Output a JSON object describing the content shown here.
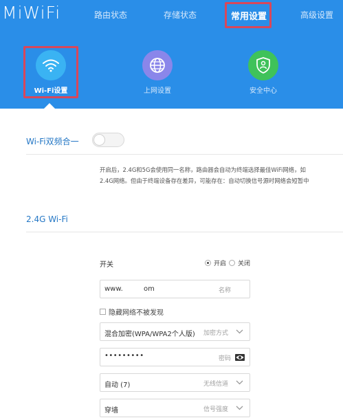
{
  "header": {
    "logo": "MiWiFi",
    "nav": [
      {
        "label": "路由状态"
      },
      {
        "label": "存储状态"
      },
      {
        "label": "常用设置"
      },
      {
        "label": "高级设置"
      }
    ],
    "sub_nav": [
      {
        "label": "Wi-Fi设置",
        "icon": "wifi-icon"
      },
      {
        "label": "上网设置",
        "icon": "globe-icon"
      },
      {
        "label": "安全中心",
        "icon": "shield-icon"
      }
    ]
  },
  "dual_band": {
    "label": "Wi-Fi双频合一",
    "enabled": false,
    "desc_line1": "开启后，2.4G和5G会使用同一名称，路由器会自动为终端选择最佳WiFi网络，如",
    "desc_line2": "2.4G网络。但由于终端设备存在差异，可能存在：自动切换信号源时网络会短暂中"
  },
  "wifi24": {
    "section_title": "2.4G Wi-Fi",
    "switch_label": "开关",
    "switch_on": "开启",
    "switch_off": "关闭",
    "ssid_value_left": "www.",
    "ssid_value_right": "om",
    "ssid_hint": "名称",
    "hide_network_label": "隐藏网络不被发现",
    "encryption_value": "混合加密(WPA/WPA2个人版)",
    "encryption_hint": "加密方式",
    "password_value": "•••••••••",
    "password_hint": "密码",
    "channel_value": "自动 (7)",
    "channel_hint": "无线信道",
    "signal_value": "穿墙",
    "signal_hint": "信号强度"
  },
  "colors": {
    "header_bg": "#2a8ee8",
    "highlight": "#d9475a",
    "wifi_circle": "#3ab3f3",
    "globe_circle": "#8a86ea",
    "shield_circle": "#3fc25a",
    "label_blue": "#2477c5"
  }
}
